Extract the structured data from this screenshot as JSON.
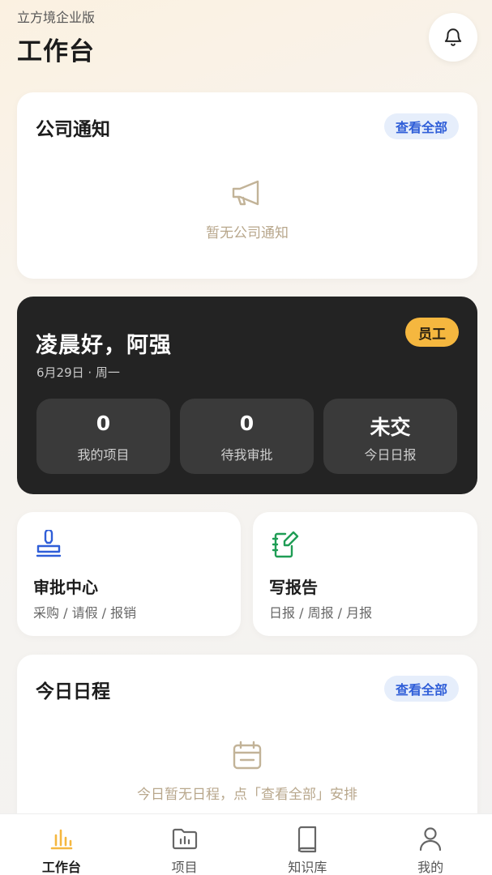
{
  "header": {
    "subtitle": "立方境企业版",
    "title": "工作台"
  },
  "notice": {
    "title": "公司通知",
    "view_all": "查看全部",
    "empty_text": "暂无公司通知"
  },
  "profile": {
    "greeting": "凌晨好，阿强",
    "date": "6月29日 · 周一",
    "role": "员工",
    "stats": [
      {
        "value": "0",
        "label": "我的项目"
      },
      {
        "value": "0",
        "label": "待我审批"
      },
      {
        "value": "未交",
        "label": "今日日报"
      }
    ]
  },
  "quick": [
    {
      "title": "审批中心",
      "desc": "采购 / 请假 / 报销",
      "icon": "stamp-icon",
      "color": "#2f5ed8"
    },
    {
      "title": "写报告",
      "desc": "日报 / 周报 / 月报",
      "icon": "edit-report-icon",
      "color": "#1f9d55"
    }
  ],
  "schedule": {
    "title": "今日日程",
    "view_all": "查看全部",
    "empty_text": "今日暂无日程，点「查看全部」安排"
  },
  "tabbar": [
    {
      "label": "工作台",
      "icon": "bar-chart-icon",
      "active": true
    },
    {
      "label": "项目",
      "icon": "project-folder-icon",
      "active": false
    },
    {
      "label": "知识库",
      "icon": "book-icon",
      "active": false
    },
    {
      "label": "我的",
      "icon": "user-icon",
      "active": false
    }
  ],
  "colors": {
    "accent": "#f5b73f",
    "link": "#2f5ed8",
    "dark_card": "#232323",
    "empty_icon": "#c2b398"
  }
}
